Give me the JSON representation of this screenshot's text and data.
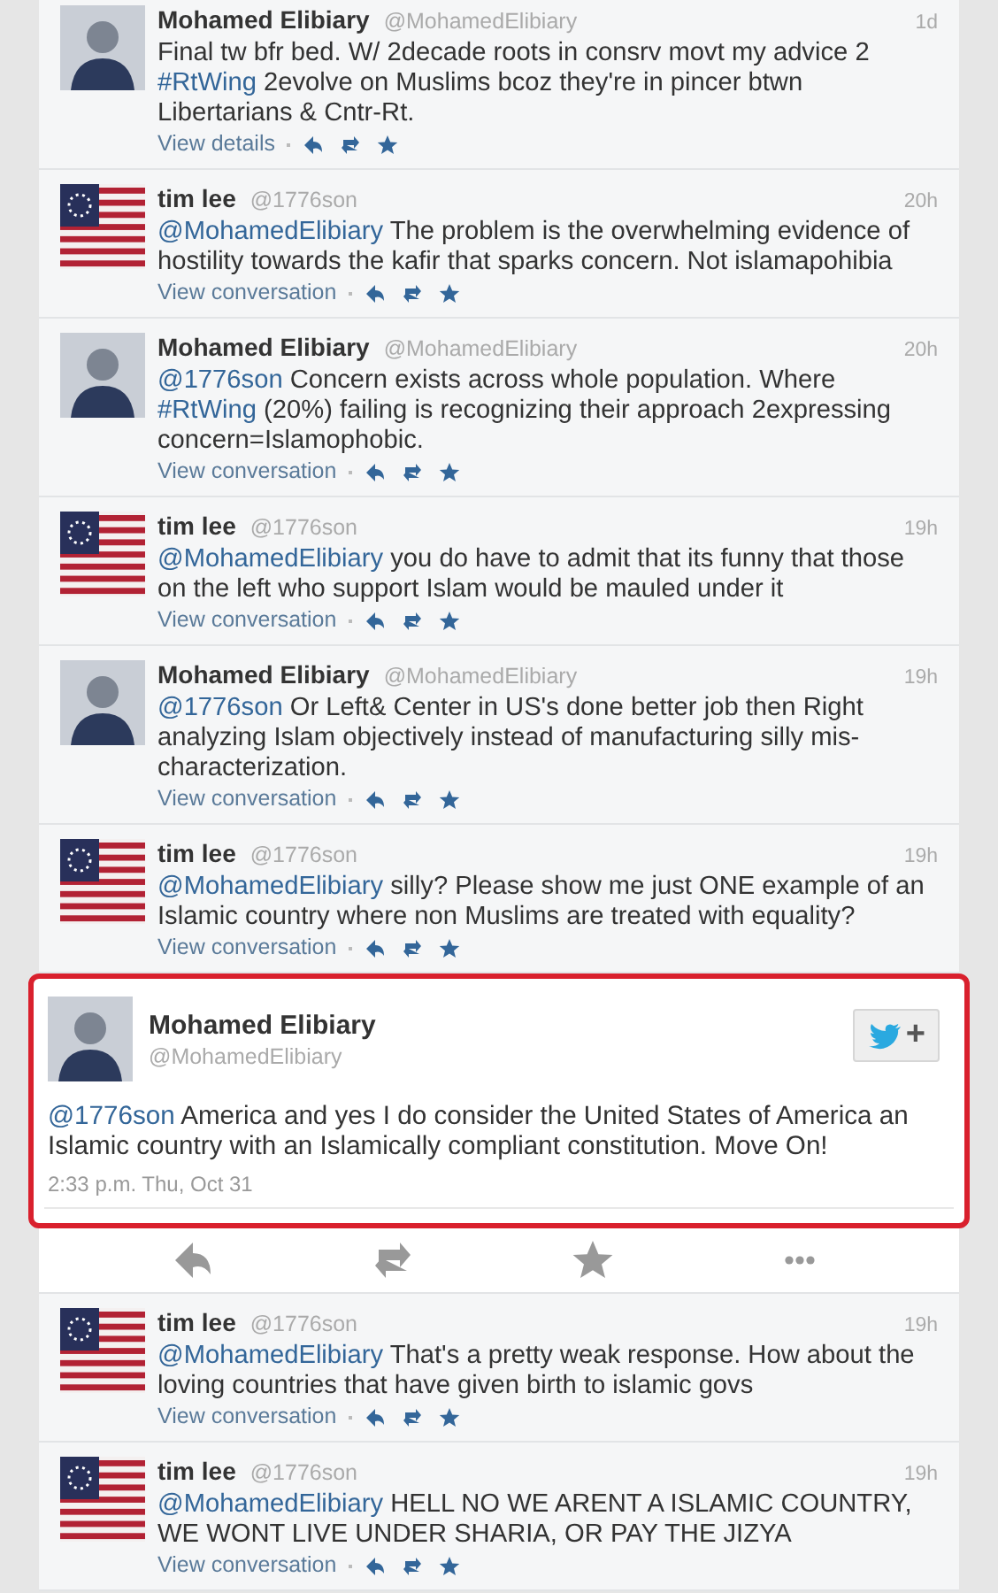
{
  "tweets": [
    {
      "kind": "compact",
      "avatar": {
        "kind": "silhouette"
      },
      "name": "Mohamed Elibiary",
      "handle": "@MohamedElibiary",
      "time": "1d",
      "body": [
        {
          "kind": "plain",
          "text": "Final tw bfr bed. W/ 2decade roots in consrv movt my advice 2 "
        },
        {
          "kind": "link",
          "text": "#RtWing"
        },
        {
          "kind": "plain",
          "text": " 2evolve on Muslims bcoz they're in pincer btwn Libertarians & Cntr-Rt."
        }
      ],
      "link": "View details"
    },
    {
      "kind": "compact",
      "avatar": {
        "kind": "picture"
      },
      "name": "tim lee",
      "handle": "@1776son",
      "time": "20h",
      "body": [
        {
          "kind": "link",
          "text": "@MohamedElibiary"
        },
        {
          "kind": "plain",
          "text": " The problem is the overwhelming evidence of hostility towards the kafir that sparks concern. Not islamapohibia"
        }
      ],
      "link": "View conversation"
    },
    {
      "kind": "compact",
      "avatar": {
        "kind": "silhouette"
      },
      "name": "Mohamed Elibiary",
      "handle": "@MohamedElibiary",
      "time": "20h",
      "body": [
        {
          "kind": "link",
          "text": "@1776son"
        },
        {
          "kind": "plain",
          "text": " Concern exists across whole population. Where "
        },
        {
          "kind": "link",
          "text": "#RtWing"
        },
        {
          "kind": "plain",
          "text": " (20%) failing is recognizing their approach 2expressing concern=Islamophobic."
        }
      ],
      "link": "View conversation"
    },
    {
      "kind": "compact",
      "avatar": {
        "kind": "picture"
      },
      "name": "tim lee",
      "handle": "@1776son",
      "time": "19h",
      "body": [
        {
          "kind": "link",
          "text": "@MohamedElibiary"
        },
        {
          "kind": "plain",
          "text": " you do have to admit that its funny that those on the left who support Islam would be mauled under it"
        }
      ],
      "link": "View conversation"
    },
    {
      "kind": "compact",
      "avatar": {
        "kind": "silhouette"
      },
      "name": "Mohamed Elibiary",
      "handle": "@MohamedElibiary",
      "time": "19h",
      "body": [
        {
          "kind": "link",
          "text": "@1776son"
        },
        {
          "kind": "plain",
          "text": " Or Left& Center in US's done better job then Right analyzing Islam objectively instead of manufacturing silly mis-characterization."
        }
      ],
      "link": "View conversation"
    },
    {
      "kind": "compact",
      "avatar": {
        "kind": "picture"
      },
      "name": "tim lee",
      "handle": "@1776son",
      "time": "19h",
      "body": [
        {
          "kind": "link",
          "text": "@MohamedElibiary"
        },
        {
          "kind": "plain",
          "text": " silly? Please show me just ONE example of an Islamic country where non Muslims are treated with equality?"
        }
      ],
      "link": "View conversation"
    },
    {
      "kind": "expanded",
      "avatar": {
        "kind": "silhouette"
      },
      "name": "Mohamed Elibiary",
      "handle": "@MohamedElibiary",
      "time": "2:33 p.m. Thu, Oct 31",
      "body": [
        {
          "kind": "link",
          "text": "@1776son"
        },
        {
          "kind": "plain",
          "text": " America and yes I do consider the United States of America an Islamic country with an Islamically compliant constitution. Move On!"
        }
      ],
      "follow": "+"
    },
    {
      "kind": "compact",
      "avatar": {
        "kind": "picture"
      },
      "name": "tim lee",
      "handle": "@1776son",
      "time": "19h",
      "body": [
        {
          "kind": "link",
          "text": "@MohamedElibiary"
        },
        {
          "kind": "plain",
          "text": " That's a pretty weak response. How about the loving countries that have given birth to islamic govs"
        }
      ],
      "link": "View conversation"
    },
    {
      "kind": "compact",
      "avatar": {
        "kind": "picture"
      },
      "name": "tim lee",
      "handle": "@1776son",
      "time": "19h",
      "body": [
        {
          "kind": "link",
          "text": "@MohamedElibiary"
        },
        {
          "kind": "plain",
          "text": " HELL NO WE ARENT A ISLAMIC COUNTRY, WE WONT LIVE UNDER SHARIA, OR PAY THE JIZYA"
        }
      ],
      "link": "View conversation"
    }
  ]
}
